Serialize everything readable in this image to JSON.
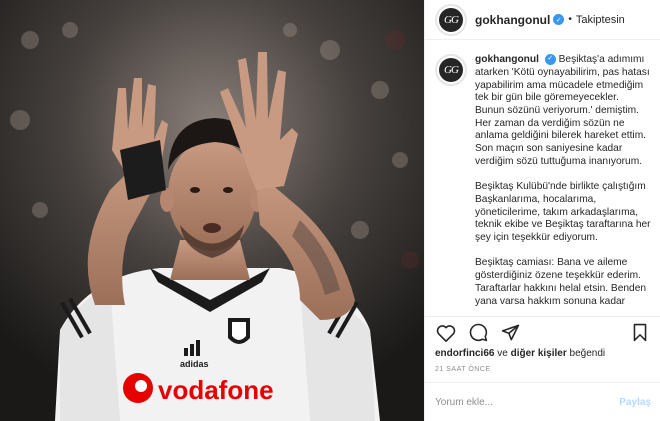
{
  "post": {
    "image_alt": "Football player in Beşiktaş Vodafone jersey applauding"
  },
  "jersey": {
    "sponsor": "vodafone",
    "brand": "adidas"
  },
  "header": {
    "username": "gokhangonul",
    "separator": "•",
    "follow_status": "Takiptesin",
    "avatar_initials": "GG"
  },
  "caption": {
    "username": "gokhangonul",
    "paragraphs": [
      "Beşiktaş'a adımımı atarken 'Kötü oynayabilirim, pas hatası yapabilirim ama mücadele etmediğim tek bir gün bile göremeyecekler. Bunun sözünü veriyorum.' demiştim. Her zaman da verdiğim sözün ne anlama geldiğini bilerek hareket ettim. Son maçın son saniyesine kadar verdiğim sözü tuttuğuma inanıyorum.",
      "Beşiktaş Kulübü'nde birlikte çalıştığım Başkanlarıma, hocalarıma, yöneticilerime, takım arkadaşlarıma, teknik ekibe ve Beşiktaş taraftarına her şey için teşekkür ediyorum.",
      "Beşiktaş camiası: Bana ve aileme gösterdiğiniz özene teşekkür ederim. Taraftarlar hakkını helal etsin. Benden yana varsa hakkım sonuna kadar"
    ]
  },
  "actions": {
    "like_icon": "heart-icon",
    "comment_icon": "comment-icon",
    "share_icon": "share-icon",
    "save_icon": "bookmark-icon"
  },
  "likes": {
    "liker": "endorfinci66",
    "connector": "ve",
    "others": "diğer kişiler",
    "suffix": "beğendi"
  },
  "timestamp": "21 SAAT ÖNCE",
  "comment": {
    "placeholder": "Yorum ekle...",
    "post_label": "Paylaş"
  },
  "colors": {
    "verified": "#3897f0",
    "post_disabled": "#b3dbff",
    "muted": "#8e8e8e",
    "text": "#262626"
  }
}
